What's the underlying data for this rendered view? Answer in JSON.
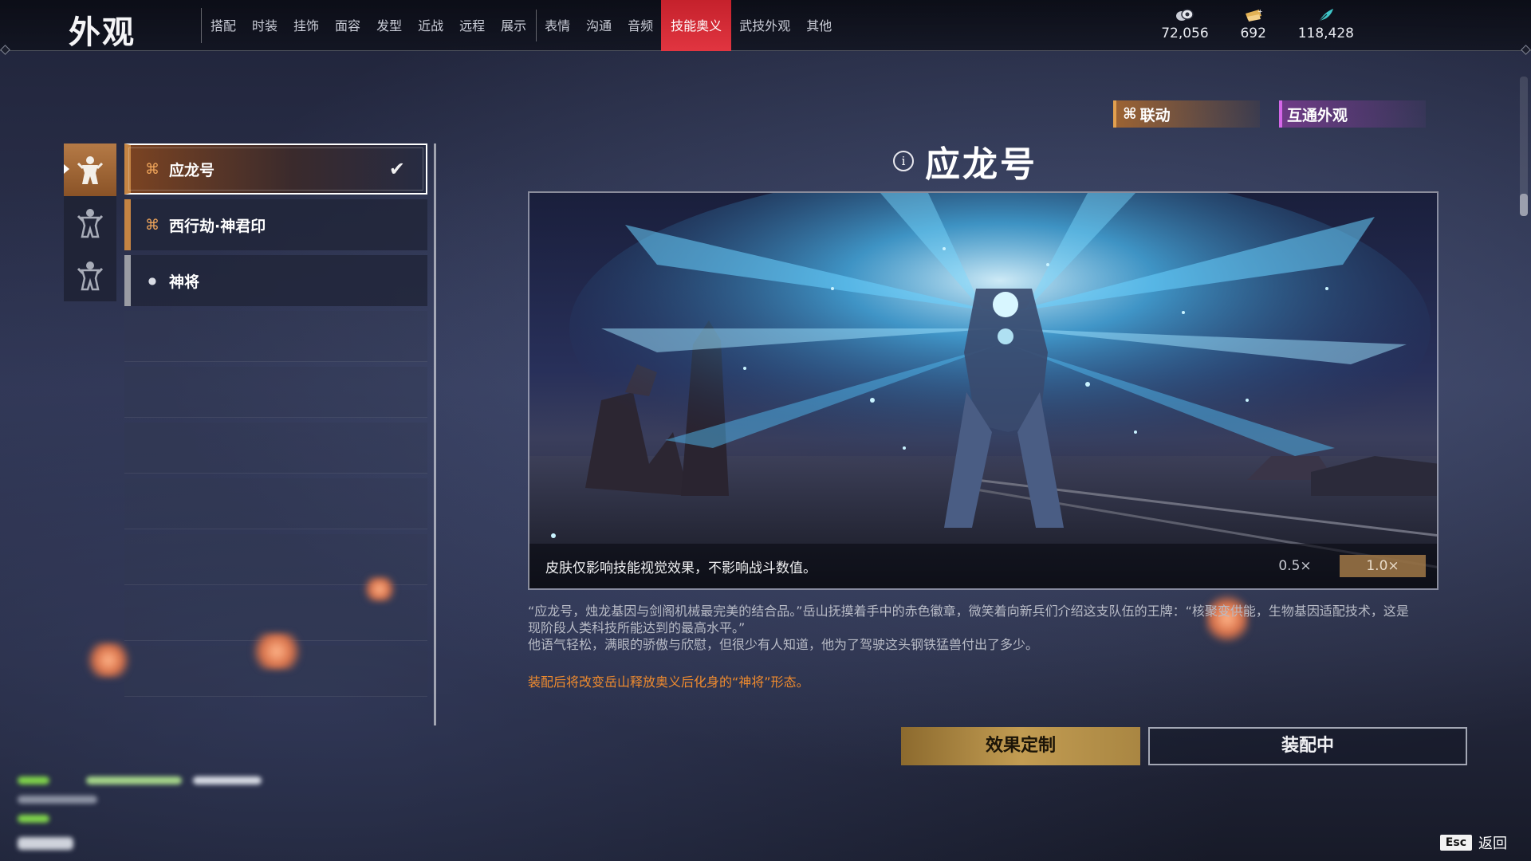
{
  "header": {
    "title": "外观",
    "tabs": [
      {
        "label": "搭配"
      },
      {
        "label": "时装"
      },
      {
        "label": "挂饰"
      },
      {
        "label": "面容"
      },
      {
        "label": "发型"
      },
      {
        "label": "近战"
      },
      {
        "label": "远程"
      },
      {
        "label": "展示"
      },
      {
        "label": "表情"
      },
      {
        "label": "沟通"
      },
      {
        "label": "音频"
      },
      {
        "label": "技能奥义"
      },
      {
        "label": "武技外观"
      },
      {
        "label": "其他"
      }
    ],
    "active_tab": "技能奥义",
    "currencies": [
      {
        "icon": "coin-stack-icon",
        "value": "72,056"
      },
      {
        "icon": "ticket-icon",
        "value": "692"
      },
      {
        "icon": "feather-icon",
        "value": "118,428"
      }
    ]
  },
  "sidebar": {
    "characters": [
      {
        "icon": "character-figure-icon",
        "active": true
      },
      {
        "icon": "character-figure-icon",
        "active": false
      },
      {
        "icon": "character-figure-icon",
        "active": false
      }
    ],
    "skins": [
      {
        "name": "应龙号",
        "selected": true,
        "equipped": true
      },
      {
        "name": "西行劫·神君印",
        "selected": false,
        "equipped": false
      },
      {
        "name": "神将",
        "selected": false,
        "equipped": false
      }
    ]
  },
  "detail": {
    "tag_collab": "联动",
    "tag_shared": "互通外观",
    "title": "应龙号",
    "caption": "皮肤仅影响技能视觉效果，不影响战斗数值。",
    "speed_options": [
      "0.5×",
      "1.0×"
    ],
    "speed_selected": "1.0×",
    "description_line1": "“应龙号，烛龙基因与剑阁机械最完美的结合品。”岳山抚摸着手中的赤色徽章，微笑着向新兵们介绍这支队伍的王牌：“核聚变供能，生物基因适配技术，这是现阶段人类科技所能达到的最高水平。”",
    "description_line2": "他语气轻松，满眼的骄傲与欣慰，但很少有人知道，他为了驾驶这头钢铁猛兽付出了多少。",
    "note": "装配后将改变岳山释放奥义后化身的“神将”形态。",
    "btn_custom": "效果定制",
    "btn_equipped": "装配中"
  },
  "footer": {
    "key": "Esc",
    "back_label": "返回"
  },
  "colors": {
    "active_tab": "#d8262f",
    "accent_orange": "#c58443",
    "note_orange": "#f08b2e",
    "gold_button": "#c29c52",
    "shared_tag_purple": "#d466e8"
  }
}
